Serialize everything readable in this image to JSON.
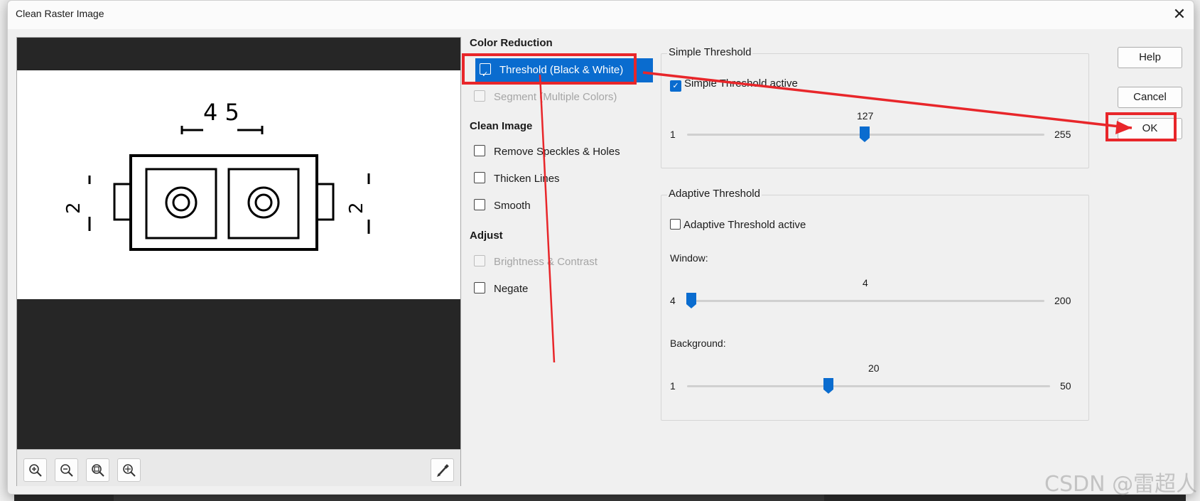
{
  "window": {
    "title": "Clean Raster Image",
    "close_symbol": "✕"
  },
  "preview": {
    "drawing_labels": {
      "top": "4 5",
      "left": "2",
      "right": "2"
    },
    "zoom_buttons": [
      "zoom-in-icon",
      "zoom-out-icon",
      "zoom-fit-icon",
      "zoom-window-icon"
    ],
    "tool_icon": "pen-icon"
  },
  "color_reduction": {
    "heading": "Color Reduction",
    "threshold_label": "Threshold (Black & White)",
    "segment_label": "Segment (Multiple Colors)"
  },
  "clean_image": {
    "heading": "Clean Image",
    "options": [
      "Remove Speckles & Holes",
      "Thicken Lines",
      "Smooth"
    ]
  },
  "adjust": {
    "heading": "Adjust",
    "brightness_label": "Brightness & Contrast",
    "negate_label": "Negate"
  },
  "simple_threshold": {
    "title": "Simple Threshold",
    "active_label": "Simple Threshold active",
    "active": true,
    "min": "1",
    "max": "255",
    "value": "127"
  },
  "adaptive_threshold": {
    "title": "Adaptive Threshold",
    "active_label": "Adaptive Threshold active",
    "active": false,
    "window": {
      "label": "Window:",
      "min": "4",
      "max": "200",
      "value": "4"
    },
    "background": {
      "label": "Background:",
      "min": "1",
      "max": "50",
      "value": "20"
    }
  },
  "buttons": {
    "help": "Help",
    "cancel": "Cancel",
    "ok": "OK"
  },
  "watermark": "CSDN @雷超人",
  "colors": {
    "accent": "#0a6ccf",
    "annotation": "#e8262a",
    "dialog_bg": "#f0f0f0"
  }
}
